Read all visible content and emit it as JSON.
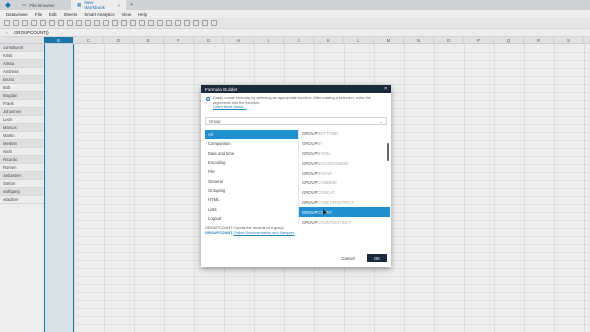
{
  "tabs": [
    {
      "label": "File Browser",
      "active": false
    },
    {
      "label": "New Workbook",
      "active": true
    }
  ],
  "menu": [
    "Dataviewer",
    "File",
    "Edit",
    "Sheets",
    "Smart Analytics",
    "View",
    "Help"
  ],
  "formula_bar": {
    "cell_name": "=",
    "formula": "GROUPCOUNT()"
  },
  "columns": [
    "B",
    "C",
    "D",
    "E",
    "F",
    "G",
    "H",
    "I",
    "J",
    "K",
    "L",
    "M",
    "N",
    "O",
    "P",
    "Q",
    "R",
    "S",
    "T"
  ],
  "selected_column": "B",
  "column_a_header": "constituent",
  "column_a_values": [
    "Kristi",
    "Alissa",
    "Andreas",
    "Bruno",
    "Bob",
    "Bogdan",
    "Frank",
    "Johannes",
    "Leon",
    "Marcus",
    "Martin",
    "Meritan",
    "Nicki",
    "Ricardo",
    "Romen",
    "Sebastien",
    "Stefan",
    "wolfgang",
    "wladimir"
  ],
  "dialog": {
    "title": "Formula Builder",
    "close": "×",
    "info": "Easily create formulas by selecting an appropriate function. After making a selection, enter the arguments into the function.",
    "learn_more": "Learn More About...",
    "search_value": "Group",
    "categories": [
      "All",
      "Comparison",
      "Date and time",
      "Encoding",
      "File",
      "General",
      "Grouping",
      "HTML",
      "Lists",
      "Logical"
    ],
    "selected_category": "All",
    "functions": [
      {
        "prefix": "GROUP",
        "rest": "BOTTOMN"
      },
      {
        "prefix": "GROUP",
        "rest": "BY"
      },
      {
        "prefix": "GROUP",
        "rest": "BYBIN"
      },
      {
        "prefix": "GROUP",
        "rest": "BYCUSTOMBIN"
      },
      {
        "prefix": "GROUP",
        "rest": "BYGAP"
      },
      {
        "prefix": "GROUP",
        "rest": "COMBINE"
      },
      {
        "prefix": "GROUP",
        "rest": "CONCAT"
      },
      {
        "prefix": "GROUP",
        "rest": "CONCATDISTINCT"
      },
      {
        "prefix": "GROUP",
        "rest": "COUNT"
      },
      {
        "prefix": "GROUP",
        "rest": "COUNTDISTINCT"
      }
    ],
    "selected_function_index": 8,
    "description": "GROUPCOUNT Counts the records of a group.",
    "doc_name": "GROUPCOUNT",
    "doc_link": "Online Documentation and Samples",
    "cancel_label": "Cancel",
    "ok_label": "OK"
  }
}
